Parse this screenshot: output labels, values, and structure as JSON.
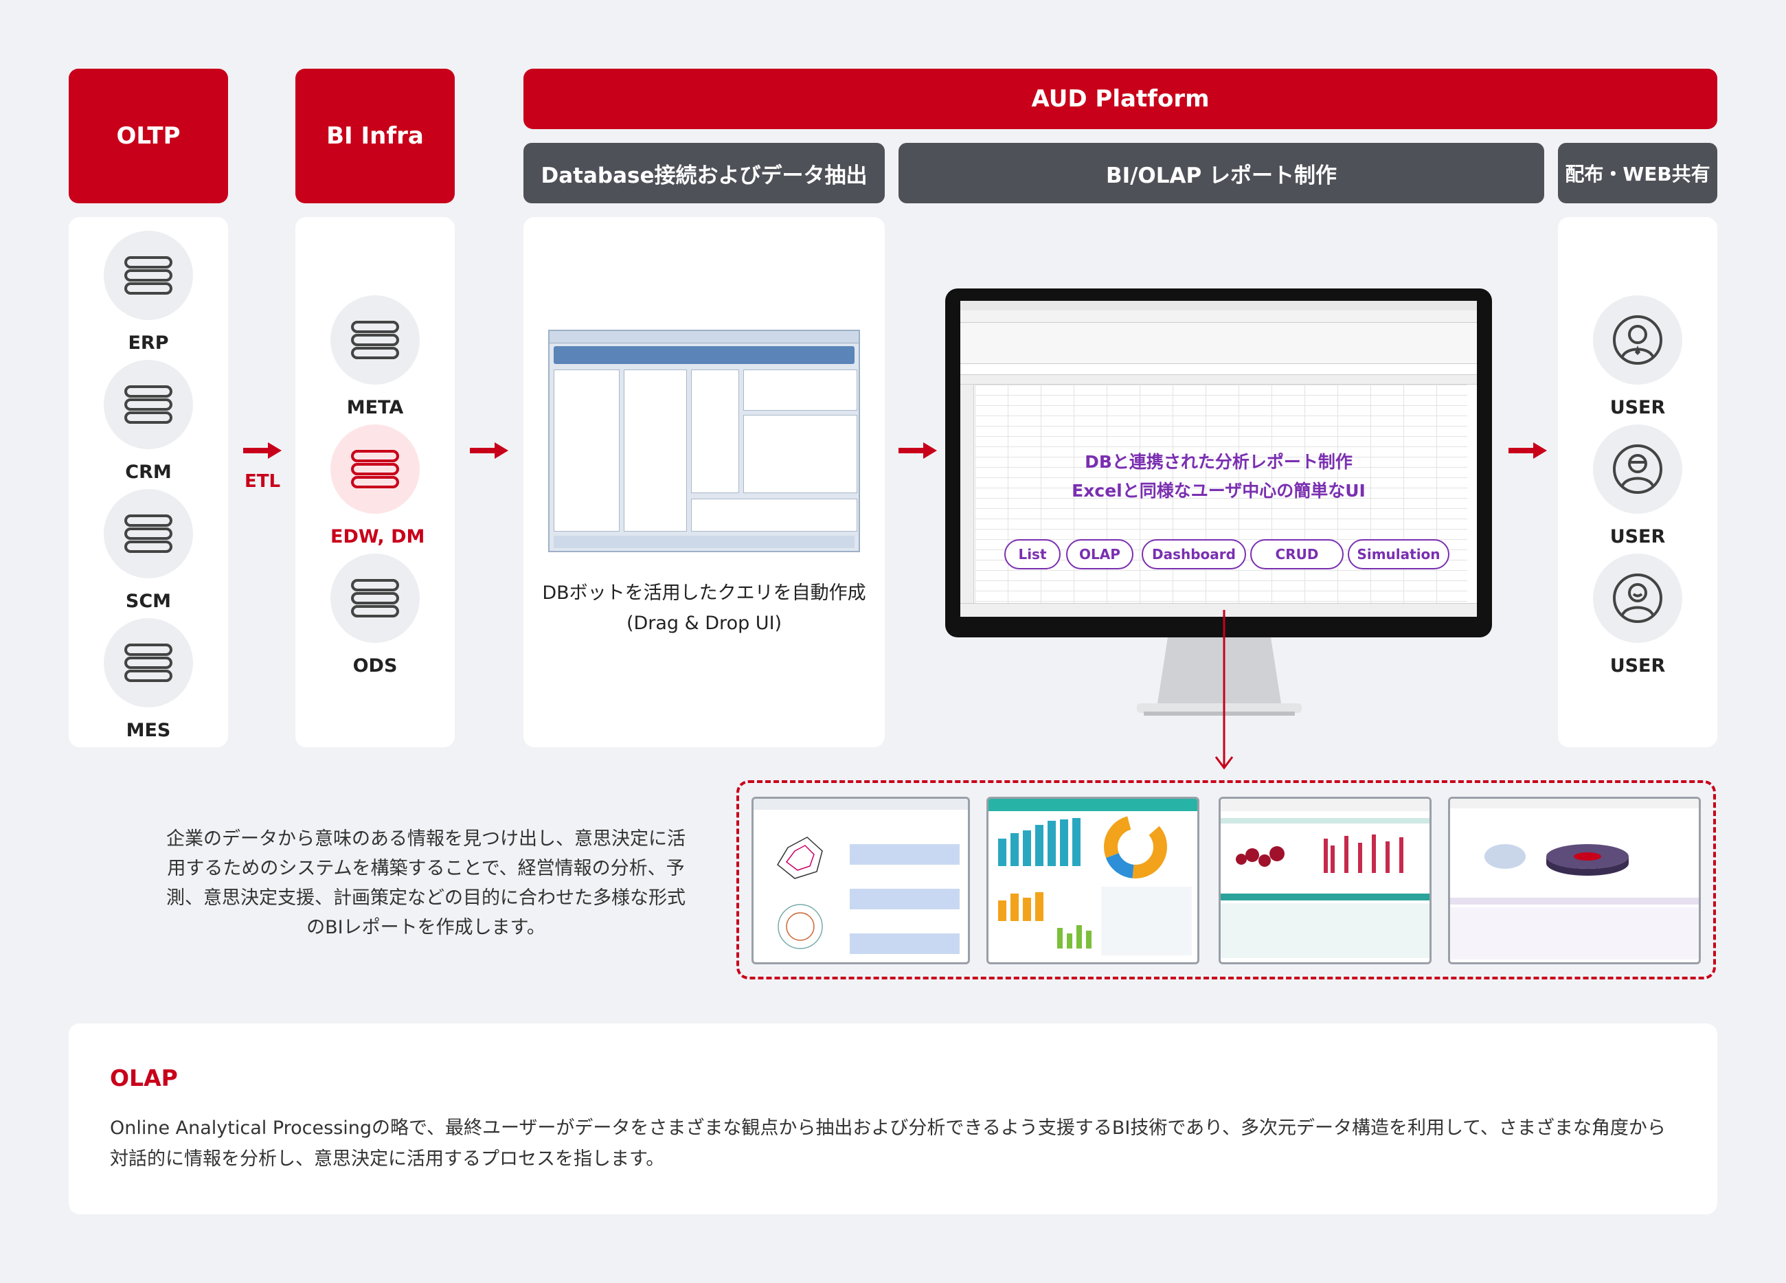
{
  "headers": {
    "oltp": "OLTP",
    "bi_infra": "BI Infra",
    "aud_platform": "AUD Platform",
    "db_extract": "Database接続およびデータ抽出",
    "bi_olap": "BI/OLAP レポート制作",
    "distribution": "配布・WEB共有"
  },
  "oltp_nodes": [
    "ERP",
    "CRM",
    "SCM",
    "MES"
  ],
  "etl_label": "ETL",
  "bi_nodes": [
    "META",
    "EDW, DM",
    "ODS"
  ],
  "db_caption_line1": "DBボットを活用したクエリを自動作成",
  "db_caption_line2": "(Drag & Drop UI)",
  "monitor_text_line1": "DBと連携された分析レポート制作",
  "monitor_text_line2": "Excelと同様なユーザ中心の簡単なUI",
  "feature_pills": [
    "List",
    "OLAP",
    "Dashboard",
    "CRUD",
    "Simulation"
  ],
  "users": [
    "USER",
    "USER",
    "USER"
  ],
  "description": "企業のデータから意味のある情報を見つけ出し、意思決定に活用するためのシステムを構築することで、経営情報の分析、予測、意思決定支援、計画策定などの目的に合わせた多様な形式のBIレポートを作成します。",
  "olap": {
    "title": "OLAP",
    "body": "Online Analytical Processingの略で、最終ユーザーがデータをさまざまな観点から抽出および分析できるよう支援するBI技術であり、多次元データ構造を利用して、さまざまな角度から対話的に情報を分析し、意思決定に活用するプロセスを指します。"
  },
  "colors": {
    "brand_red": "#c8001a",
    "header_gray": "#4f5158",
    "accent_purple": "#7a2fb0",
    "background": "#f1f2f5"
  },
  "icons": {
    "database": "database-icon",
    "user": "user-icon",
    "arrow": "arrow-right-icon"
  }
}
